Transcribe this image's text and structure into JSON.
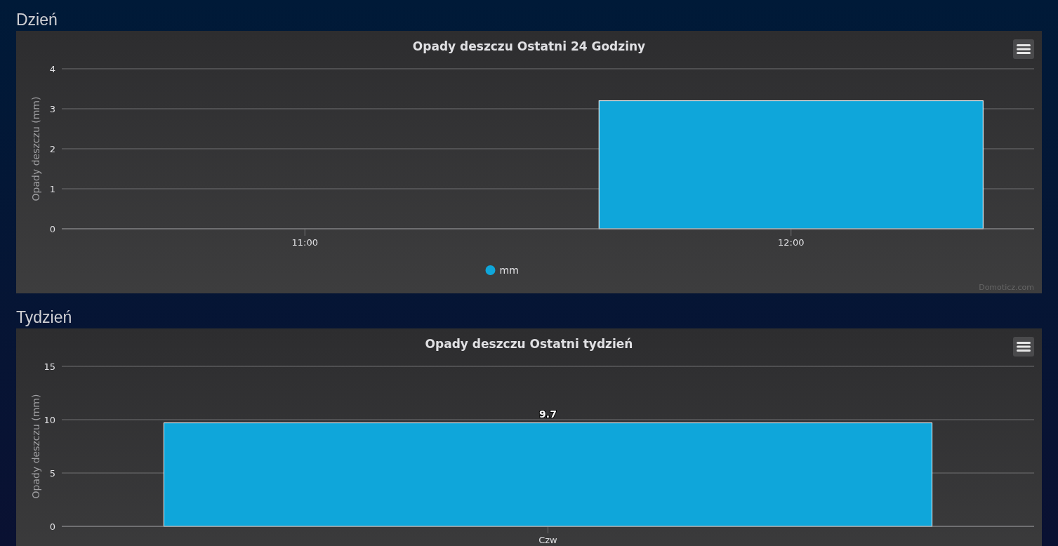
{
  "sections": [
    {
      "heading": "Dzień",
      "chart": {
        "credits": "Domoticz.com",
        "chart_data": {
          "type": "bar",
          "title": "Opady deszczu Ostatni 24 Godziny",
          "ylabel": "Opady deszczu (mm)",
          "categories": [
            "11:00",
            "12:00"
          ],
          "ylim": [
            0,
            4
          ],
          "yticks": [
            0,
            1,
            2,
            3,
            4
          ],
          "grid": true,
          "data_labels": false,
          "series": [
            {
              "name": "mm",
              "color": "#0fa6da",
              "values": [
                null,
                3.2
              ]
            }
          ]
        }
      }
    },
    {
      "heading": "Tydzień",
      "chart": {
        "chart_data": {
          "type": "bar",
          "title": "Opady deszczu Ostatni tydzień",
          "ylabel": "Opady deszczu (mm)",
          "categories": [
            "Czw"
          ],
          "ylim": [
            0,
            15
          ],
          "yticks": [
            0,
            5,
            10,
            15
          ],
          "grid": true,
          "data_labels": true,
          "series": [
            {
              "color": "#0fa6da",
              "values": [
                9.7
              ]
            }
          ]
        }
      }
    }
  ]
}
